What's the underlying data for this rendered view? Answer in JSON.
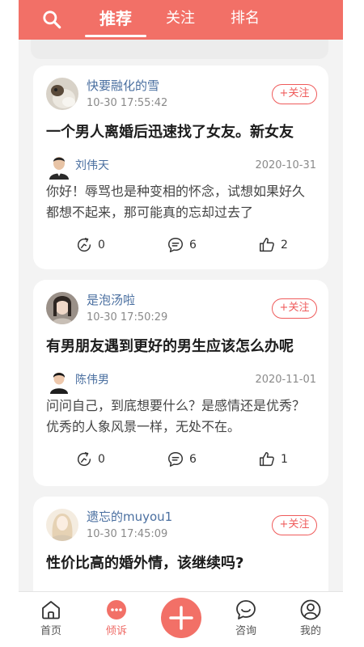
{
  "header": {
    "tabs": [
      {
        "label": "推荐",
        "active": true
      },
      {
        "label": "关注",
        "active": false
      },
      {
        "label": "排名",
        "active": false
      }
    ]
  },
  "posts": [
    {
      "user": "快要融化的雪",
      "time": "10-30 17:55:42",
      "follow_label": "+关注",
      "title": "一个男人离婚后迅速找了女友。新女友",
      "answerer": "刘伟天",
      "answer_date": "2020-10-31",
      "text": "你好！辱骂也是种变相的怀念，试想如果好久都想不起来，那可能真的忘却过去了",
      "shares": "0",
      "comments": "6",
      "likes": "2"
    },
    {
      "user": "是泡汤啦",
      "time": "10-30 17:50:29",
      "follow_label": "+关注",
      "title": "有男朋友遇到更好的男生应该怎么办呢",
      "answerer": "陈伟男",
      "answer_date": "2020-11-01",
      "text": "问问自己，到底想要什么？是感情还是优秀？优秀的人象风景一样，无处不在。",
      "shares": "0",
      "comments": "6",
      "likes": "1"
    },
    {
      "user": "遗忘的muyou1",
      "time": "10-30 17:45:09",
      "follow_label": "+关注",
      "title": "性价比高的婚外情，该继续吗?"
    }
  ],
  "nav": [
    {
      "label": "首页",
      "icon": "home-icon"
    },
    {
      "label": "倾诉",
      "icon": "chat-bubble-icon",
      "active": true
    },
    {
      "label": "",
      "icon": "plus-icon"
    },
    {
      "label": "咨询",
      "icon": "smile-chat-icon"
    },
    {
      "label": "我的",
      "icon": "profile-icon"
    }
  ],
  "colors": {
    "accent": "#f27067",
    "follow": "#ef5b5b",
    "username": "#4a6fa0",
    "background": "#f3f3f3"
  }
}
